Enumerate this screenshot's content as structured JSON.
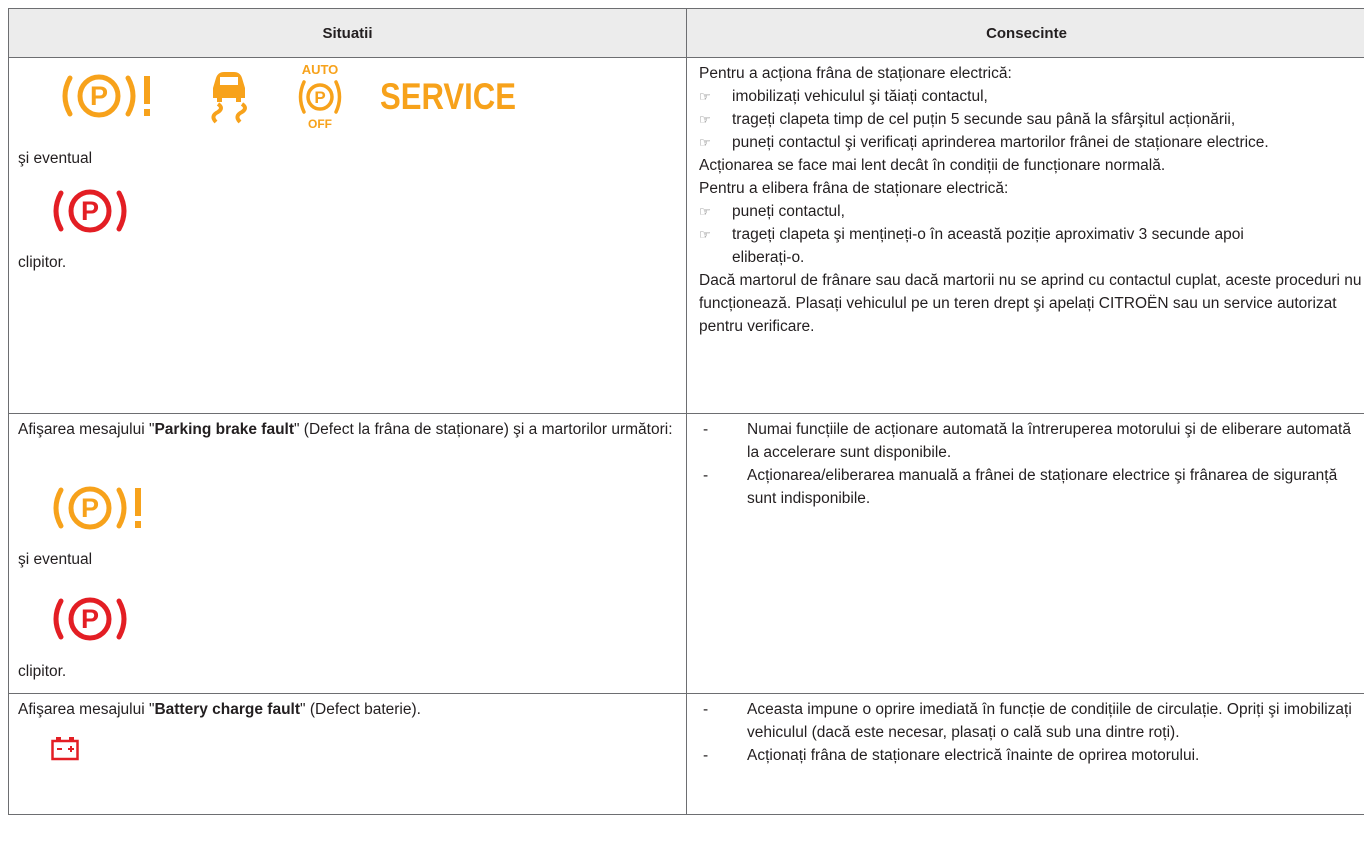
{
  "header": {
    "situations": "Situatii",
    "consequences": "Consecinte"
  },
  "colors": {
    "amber": "#f7a21b",
    "red": "#e31e24",
    "header_bg": "#ececec",
    "border": "#6d6e71"
  },
  "icons": [
    "parking-brake-warning-icon",
    "esp-skid-icon",
    "auto-p-off-icon",
    "service-icon",
    "parking-brake-red-icon",
    "battery-icon"
  ],
  "rows": [
    {
      "situation": {
        "service_text": "SERVICE",
        "auto_text": "AUTO",
        "off_text": "OFF",
        "eventual": "şi eventual",
        "blinking": "clipitor."
      },
      "consequence": {
        "apply_intro": "Pentru a acționa frâna de staționare electrică:",
        "apply_steps": [
          "imobilizați vehiculul şi tăiați contactul,",
          "trageți clapeta timp de cel puțin 5 secunde sau până la sfârşitul acționării,",
          "puneți contactul şi verificați aprinderea martorilor frânei de staționare electrice."
        ],
        "slower_note": "Acționarea se face mai lent decât în condiții de funcționare normală.",
        "release_intro": "Pentru a elibera frâna de staționare electrică:",
        "release_steps": [
          "puneți contactul,",
          "trageți clapeta şi mențineți-o în această poziție aproximativ 3 secunde apoi eliberați-o."
        ],
        "final_note": "Dacă martorul de frânare sau dacă martorii nu se aprind cu contactul cuplat, aceste proceduri nu funcționează. Plasați vehiculul pe un teren drept şi apelați CITROËN sau un service autorizat pentru verificare."
      }
    },
    {
      "situation": {
        "prefix": "Afişarea mesajului \"",
        "message": "Parking brake fault",
        "suffix": "\" (Defect la frâna de staționare) şi a martorilor următori:",
        "eventual": "şi eventual",
        "blinking": "clipitor."
      },
      "consequence": {
        "items": [
          "Numai funcțiile de acționare automată la întreruperea motorului şi de eliberare automată la accelerare sunt disponibile.",
          "Acționarea/eliberarea manuală a frânei de staționare electrice şi frânarea de siguranță sunt indisponibile."
        ]
      }
    },
    {
      "situation": {
        "prefix": "Afişarea mesajului \"",
        "message": "Battery charge fault",
        "suffix": "\" (Defect baterie)."
      },
      "consequence": {
        "items": [
          "Aceasta impune o oprire imediată în funcție de condițiile de circulație. Opriți şi imobilizați vehiculul (dacă este necesar, plasați o cală sub una dintre roți).",
          "Acționați frâna de staționare electrică înainte de oprirea motorului."
        ]
      }
    }
  ],
  "markers": {
    "hand": "☞",
    "dash": "-"
  }
}
